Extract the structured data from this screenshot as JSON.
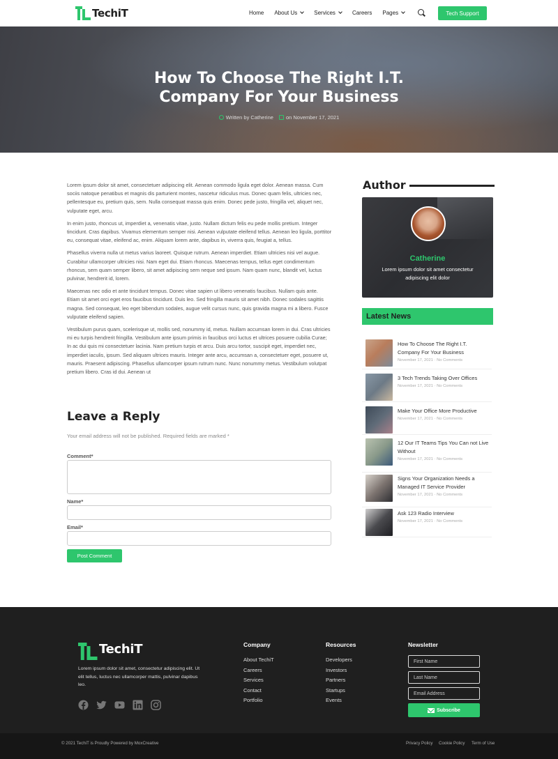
{
  "brand": {
    "name": "TechiT",
    "accent": "#2ec66d"
  },
  "nav": {
    "items": [
      {
        "label": "Home"
      },
      {
        "label": "About Us"
      },
      {
        "label": "Services"
      },
      {
        "label": "Careers"
      },
      {
        "label": "Pages"
      }
    ],
    "cta": "Tech Support"
  },
  "hero": {
    "title": "How To Choose The Right I.T. Company For Your Business",
    "author": "Written by Catherine",
    "date": "on November 17, 2021"
  },
  "article": {
    "paragraphs": [
      "Lorem ipsum dolor sit amet, consectetuer adipiscing elit. Aenean commodo ligula eget dolor. Aenean massa. Cum sociis natoque penatibus et magnis dis parturient montes, nascetur ridiculus mus. Donec quam felis, ultricies nec, pellentesque eu, pretium quis, sem. Nulla consequat massa quis enim. Donec pede justo, fringilla vel, aliquet nec, vulputate eget, arcu.",
      "In enim justo, rhoncus ut, imperdiet a, venenatis vitae, justo. Nullam dictum felis eu pede mollis pretium. Integer tincidunt. Cras dapibus. Vivamus elementum semper nisi. Aenean vulputate eleifend tellus. Aenean leo ligula, porttitor eu, consequat vitae, eleifend ac, enim. Aliquam lorem ante, dapibus in, viverra quis, feugiat a, tellus.",
      "Phasellus viverra nulla ut metus varius laoreet. Quisque rutrum. Aenean imperdiet. Etiam ultricies nisi vel augue. Curabitur ullamcorper ultricies nisi. Nam eget dui. Etiam rhoncus. Maecenas tempus, tellus eget condimentum rhoncus, sem quam semper libero, sit amet adipiscing sem neque sed ipsum. Nam quam nunc, blandit vel, luctus pulvinar, hendrerit id, lorem.",
      "Maecenas nec odio et ante tincidunt tempus. Donec vitae sapien ut libero venenatis faucibus. Nullam quis ante. Etiam sit amet orci eget eros faucibus tincidunt. Duis leo. Sed fringilla mauris sit amet nibh. Donec sodales sagittis magna. Sed consequat, leo eget bibendum sodales, augue velit cursus nunc, quis gravida magna mi a libero. Fusce vulputate eleifend sapien.",
      "Vestibulum purus quam, scelerisque ut, mollis sed, nonummy id, metus. Nullam accumsan lorem in dui. Cras ultricies mi eu turpis hendrerit fringilla. Vestibulum ante ipsum primis in faucibus orci luctus et ultrices posuere cubilia Curae; In ac dui quis mi consectetuer lacinia. Nam pretium turpis et arcu. Duis arcu tortor, suscipit eget, imperdiet nec, imperdiet iaculis, ipsum. Sed aliquam ultrices mauris. Integer ante arcu, accumsan a, consectetuer eget, posuere ut, mauris. Praesent adipiscing. Phasellus ullamcorper ipsum rutrum nunc. Nunc nonummy metus. Vestibulum volutpat pretium libero. Cras id dui. Aenean ut"
    ]
  },
  "reply": {
    "title": "Leave a Reply",
    "note": "Your email address will not be published. Required fields are marked *",
    "comment_label": "Comment*",
    "name_label": "Name*",
    "email_label": "Email*",
    "comment_value": "",
    "name_value": "",
    "email_value": "",
    "submit": "Post Comment"
  },
  "sidebar": {
    "author_heading": "Author",
    "author_name": "Catherine",
    "author_bio": "Lorem ipsum dolor sit amet consectetur adipiscing elit dolor",
    "news_heading": "Latest News",
    "news": [
      {
        "title": "How To Choose The Right I.T. Company For Your Business",
        "date": "November 17, 2021",
        "comments": "No Comments",
        "thumb": "#b97d5c"
      },
      {
        "title": "3 Tech Trends Taking Over Offices",
        "date": "November 17, 2021",
        "comments": "No Comments",
        "thumb": "#6d7a86"
      },
      {
        "title": "Make Your Office More Productive",
        "date": "November 17, 2021",
        "comments": "No Comments",
        "thumb": "#5f6b78"
      },
      {
        "title": "12 Our IT Teams Tips You Can not Live Without",
        "date": "November 17, 2021",
        "comments": "No Comments",
        "thumb": "#8a9a8a"
      },
      {
        "title": "Signs Your Organization Needs a Managed IT Service Provider",
        "date": "November 17, 2021",
        "comments": "No Comments",
        "thumb": "#7d7470"
      },
      {
        "title": "Ask 123 Radio Interview",
        "date": "November 17, 2021",
        "comments": "No Comments",
        "thumb": "#4a4a4e"
      }
    ]
  },
  "footer": {
    "description": "Lorem ipsum dolor sit amet, consectetur adipiscing elit. Ut elit tellus, luctus nec ullamcorper mattis, pulvinar dapibus leo.",
    "company": {
      "title": "Company",
      "links": [
        "About TechiT",
        "Careers",
        "Services",
        "Contact",
        "Portfolio"
      ]
    },
    "resources": {
      "title": "Resources",
      "links": [
        "Developers",
        "Investors",
        "Partners",
        "Startups",
        "Events"
      ]
    },
    "newsletter": {
      "title": "Newsletter",
      "first_name": "First Name",
      "last_name": "Last Name",
      "email": "Email Address",
      "button": "Subscribe"
    },
    "socials": [
      "facebook-icon",
      "twitter-icon",
      "youtube-icon",
      "linkedin-icon",
      "instagram-icon"
    ],
    "copyright": "© 2021 TechiT is Proudly Powered by MoxCreative",
    "legal": [
      "Privacy Policy",
      "Cookie Policy",
      "Term of Use"
    ]
  }
}
